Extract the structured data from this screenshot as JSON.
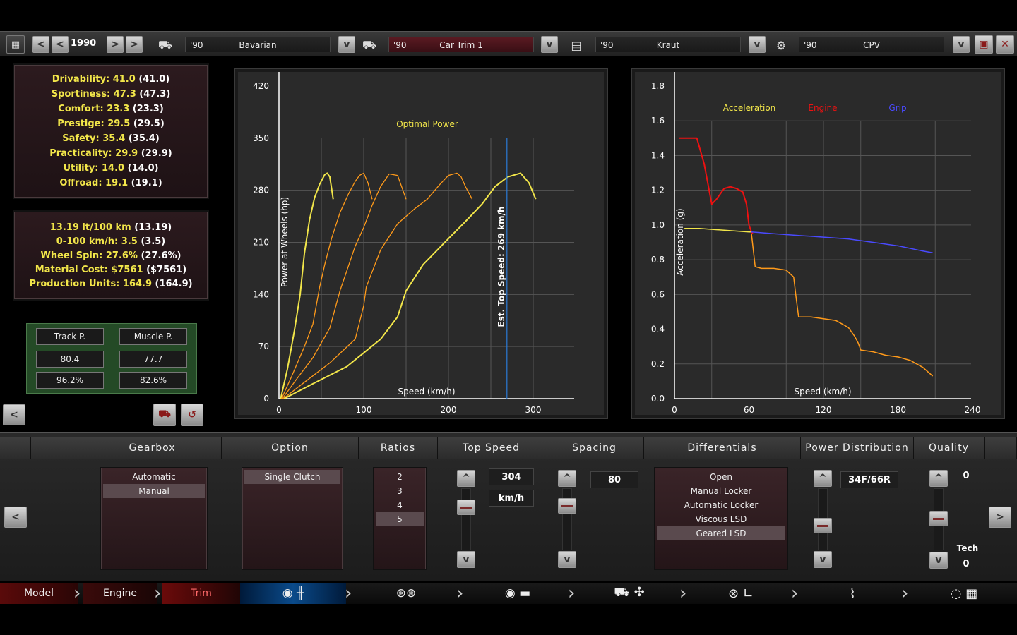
{
  "topbar": {
    "year": "1990",
    "model": {
      "year": "'90",
      "name": "Bavarian"
    },
    "trim": {
      "year": "'90",
      "name": "Car Trim 1"
    },
    "engine": {
      "year": "'90",
      "name": "Kraut"
    },
    "family": {
      "year": "'90",
      "name": "CPV"
    }
  },
  "stats": [
    {
      "label": "Drivability: 41.0",
      "paren": "(41.0)"
    },
    {
      "label": "Sportiness: 47.3",
      "paren": "(47.3)"
    },
    {
      "label": "Comfort: 23.3",
      "paren": "(23.3)"
    },
    {
      "label": "Prestige: 29.5",
      "paren": "(29.5)"
    },
    {
      "label": "Safety: 35.4",
      "paren": "(35.4)"
    },
    {
      "label": "Practicality: 29.9",
      "paren": "(29.9)"
    },
    {
      "label": "Utility: 14.0",
      "paren": "(14.0)"
    },
    {
      "label": "Offroad: 19.1",
      "paren": "(19.1)"
    }
  ],
  "metrics": [
    {
      "label": "13.19 lt/100 km",
      "paren": "(13.19)"
    },
    {
      "label": "0-100 km/h: 3.5",
      "paren": "(3.5)"
    },
    {
      "label": "Wheel Spin: 27.6%",
      "paren": "(27.6%)"
    },
    {
      "label": "Material Cost: $7561",
      "paren": "($7561)"
    },
    {
      "label": "Production Units: 164.9",
      "paren": "(164.9)"
    }
  ],
  "scores": {
    "track_label": "Track P.",
    "muscle_label": "Muscle P.",
    "track_val": "80.4",
    "muscle_val": "77.7",
    "track_pct": "96.2%",
    "muscle_pct": "82.6%"
  },
  "gearbox": {
    "header": "Gearbox",
    "items": [
      "Automatic",
      "Manual"
    ],
    "selected": 1
  },
  "option": {
    "header": "Option",
    "items": [
      "Single Clutch"
    ],
    "selected": 0
  },
  "ratios": {
    "header": "Ratios",
    "items": [
      "2",
      "3",
      "4",
      "5"
    ],
    "selected": 3
  },
  "topspeed": {
    "header": "Top Speed",
    "value": "304",
    "unit": "km/h"
  },
  "spacing": {
    "header": "Spacing",
    "value": "80"
  },
  "differentials": {
    "header": "Differentials",
    "items": [
      "Open",
      "Manual Locker",
      "Automatic Locker",
      "Viscous LSD",
      "Geared LSD"
    ],
    "selected": 4
  },
  "powerdist": {
    "header": "Power Distribution",
    "value": "34F/66R"
  },
  "quality": {
    "header": "Quality",
    "value": "0",
    "tech_label": "Tech",
    "tech_value": "0"
  },
  "tabs": {
    "model": "Model",
    "engine": "Engine",
    "trim": "Trim"
  },
  "colors": {
    "yellow": "#f2e64a",
    "orange": "#ff9a1a",
    "red": "#ee1111",
    "blue": "#4a4aff"
  },
  "chart_data": [
    {
      "type": "line",
      "title": "Optimal Power",
      "xlabel": "Speed (km/h)",
      "ylabel": "Power at Wheels (hp)",
      "xlim": [
        0,
        350
      ],
      "ylim": [
        0,
        420
      ],
      "xticks": [
        "0",
        "100",
        "200",
        "300"
      ],
      "yticks": [
        "0",
        "70",
        "140",
        "210",
        "280",
        "350",
        "420"
      ],
      "annotation": "Est. Top Speed: 269 km/h",
      "annotation_x": 269,
      "series": [
        {
          "x": [
            2,
            10,
            18,
            25,
            30,
            36,
            42,
            48,
            54,
            57,
            60,
            64
          ],
          "y": [
            0,
            40,
            90,
            140,
            195,
            240,
            270,
            288,
            301,
            303,
            298,
            268
          ]
        },
        {
          "x": [
            3,
            15,
            30,
            40,
            48,
            54,
            62,
            72,
            82,
            90,
            95,
            100,
            105,
            110
          ],
          "y": [
            0,
            30,
            70,
            100,
            150,
            180,
            215,
            250,
            275,
            292,
            300,
            303,
            290,
            268
          ]
        },
        {
          "x": [
            4,
            20,
            40,
            60,
            72,
            78,
            90,
            100,
            110,
            120,
            130,
            140,
            150
          ],
          "y": [
            0,
            25,
            55,
            95,
            145,
            165,
            205,
            230,
            260,
            285,
            302,
            300,
            268
          ]
        },
        {
          "x": [
            5,
            30,
            60,
            90,
            100,
            103,
            120,
            140,
            160,
            175,
            190,
            200,
            210,
            215,
            220,
            228
          ],
          "y": [
            0,
            22,
            48,
            80,
            125,
            150,
            200,
            235,
            255,
            268,
            288,
            300,
            303,
            298,
            285,
            268
          ]
        },
        {
          "x": [
            6,
            40,
            80,
            120,
            140,
            150,
            170,
            200,
            220,
            240,
            255,
            270,
            285,
            295,
            303
          ],
          "y": [
            0,
            20,
            43,
            80,
            110,
            145,
            180,
            215,
            238,
            262,
            285,
            298,
            303,
            290,
            268
          ]
        }
      ]
    },
    {
      "type": "line",
      "xlabel": "Speed (km/h)",
      "ylabel": "Acceleration (g)",
      "xlim": [
        0,
        240
      ],
      "ylim": [
        0,
        1.8
      ],
      "xticks": [
        "0",
        "60",
        "120",
        "180",
        "240"
      ],
      "yticks": [
        "0.0",
        "0.2",
        "0.4",
        "0.6",
        "0.8",
        "1.0",
        "1.2",
        "1.4",
        "1.6",
        "1.8"
      ],
      "series": [
        {
          "name": "Acceleration",
          "x": [
            8,
            20,
            40,
            60,
            62
          ],
          "y": [
            0.98,
            0.98,
            0.97,
            0.96,
            0.96
          ]
        },
        {
          "name": "Engine",
          "x": [
            4,
            18,
            24,
            30,
            34,
            40,
            45,
            50,
            55,
            58,
            60,
            62,
            63
          ],
          "y": [
            1.5,
            1.5,
            1.35,
            1.12,
            1.15,
            1.21,
            1.22,
            1.21,
            1.19,
            1.12,
            1.0,
            0.96,
            0.95
          ]
        },
        {
          "name": "Grip",
          "x": [
            62,
            80,
            100,
            120,
            140,
            160,
            180,
            200,
            208
          ],
          "y": [
            0.96,
            0.95,
            0.94,
            0.93,
            0.92,
            0.9,
            0.88,
            0.85,
            0.84
          ]
        },
        {
          "name": "",
          "x": [
            62,
            65,
            70,
            80,
            90,
            96,
            98,
            100,
            110,
            120,
            130,
            140,
            145,
            148,
            150,
            160,
            170,
            180,
            190,
            200,
            208
          ],
          "y": [
            0.95,
            0.76,
            0.75,
            0.75,
            0.74,
            0.7,
            0.58,
            0.47,
            0.47,
            0.46,
            0.45,
            0.41,
            0.36,
            0.32,
            0.28,
            0.27,
            0.25,
            0.24,
            0.22,
            0.18,
            0.13
          ]
        }
      ]
    }
  ]
}
